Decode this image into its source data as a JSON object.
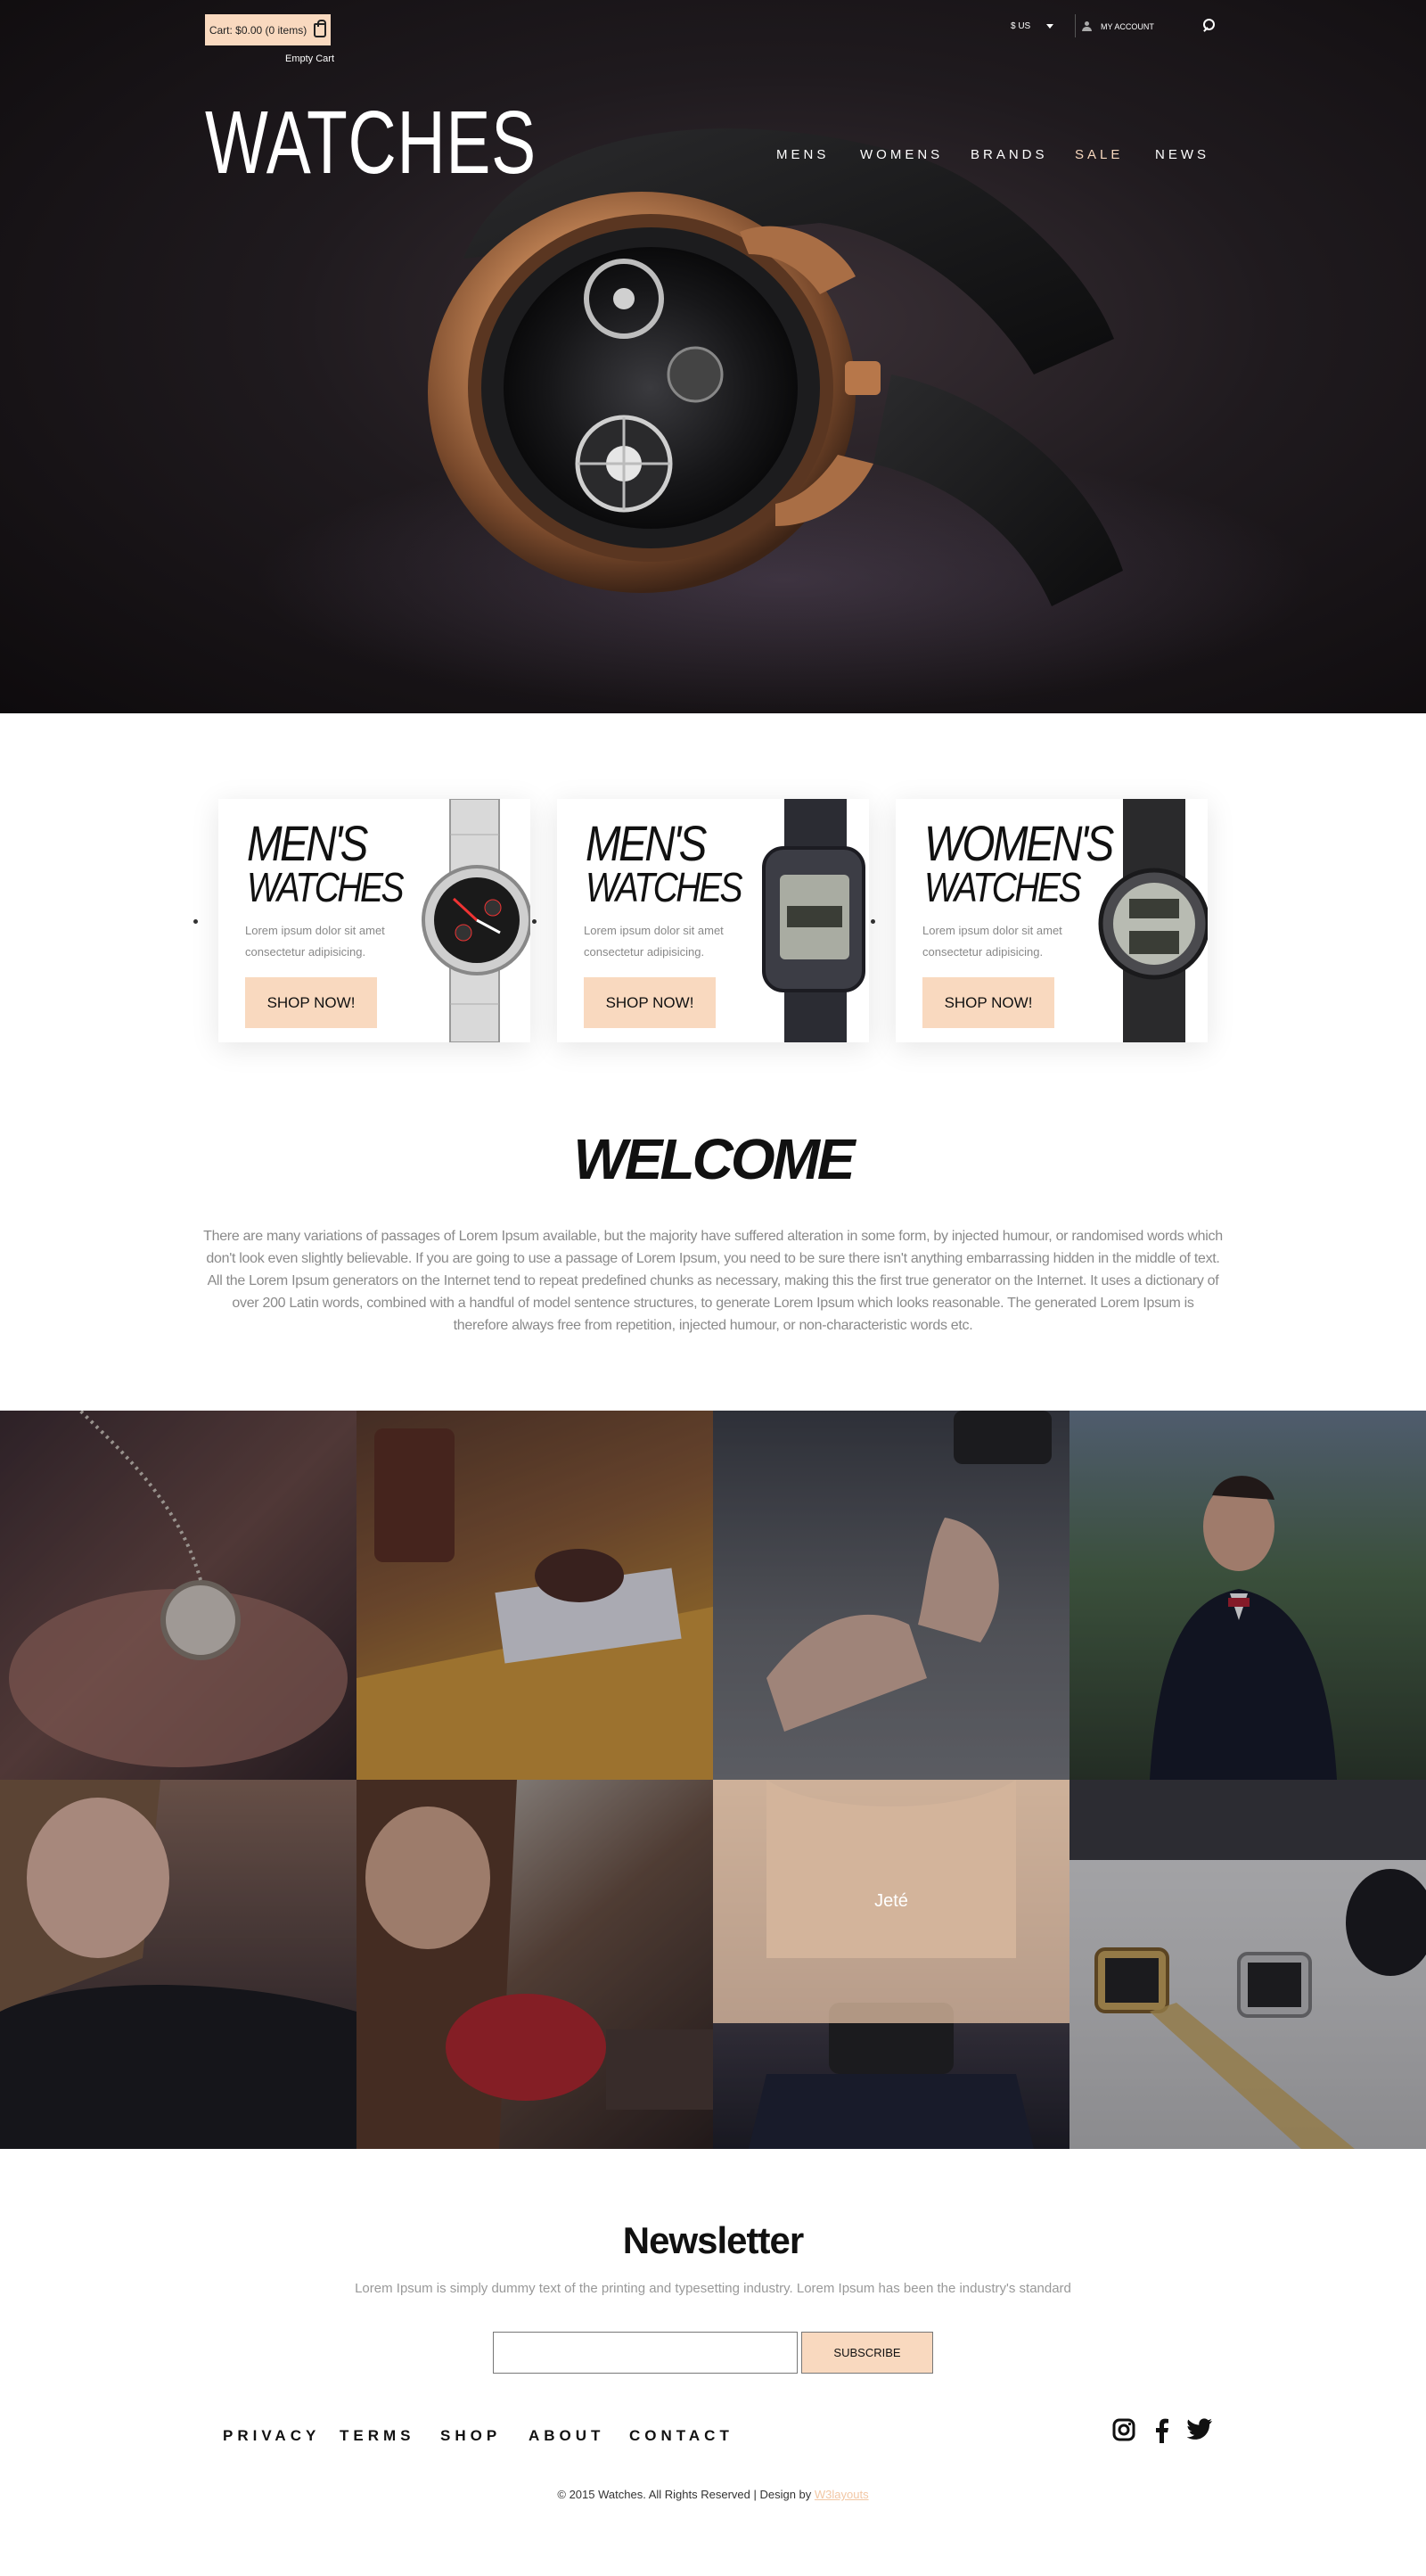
{
  "header": {
    "cart_label": "Cart: $0.00 (0 items)",
    "empty_cart": "Empty Cart",
    "currency": "$ US",
    "account": "MY ACCOUNT",
    "logo": "WATCHES",
    "nav": [
      "MENS",
      "WOMENS",
      "BRANDS",
      "SALE",
      "NEWS"
    ],
    "accent_color": "#f9d9bf"
  },
  "promos": [
    {
      "title1": "MEN'S",
      "title2": "WATCHES",
      "desc": "Lorem ipsum dolor sit amet consectetur adipisicing.",
      "button": "SHOP NOW!"
    },
    {
      "title1": "MEN'S",
      "title2": "WATCHES",
      "desc": "Lorem ipsum dolor sit amet consectetur adipisicing.",
      "button": "SHOP NOW!"
    },
    {
      "title1": "WOMEN'S",
      "title2": "WATCHES",
      "desc": "Lorem ipsum dolor sit amet consectetur adipisicing.",
      "button": "SHOP NOW!"
    }
  ],
  "welcome": {
    "title": "WELCOME",
    "text": "There are many variations of passages of Lorem Ipsum available, but the majority have suffered alteration in some form, by injected humour, or randomised words which don't look even slightly believable. If you are going to use a passage of Lorem Ipsum, you need to be sure there isn't anything embarrassing hidden in the middle of text. All the Lorem Ipsum generators on the Internet tend to repeat predefined chunks as necessary, making this the first true generator on the Internet. It uses a dictionary of over 200 Latin words, combined with a handful of model sentence structures, to generate Lorem Ipsum which looks reasonable. The generated Lorem Ipsum is therefore always free from repetition, injected humour, or non-characteristic words etc."
  },
  "gallery": {
    "hover_label": "Jeté"
  },
  "newsletter": {
    "title": "Newsletter",
    "subtitle": "Lorem Ipsum is simply dummy text of the printing and typesetting industry. Lorem Ipsum has been the industry's standard",
    "button": "SUBSCRIBE"
  },
  "footer": {
    "links": [
      "PRIVACY",
      "TERMS",
      "SHOP",
      "ABOUT",
      "CONTACT"
    ],
    "copyright": "© 2015 Watches. All Rights Reserved | Design by ",
    "designer": "W3layouts",
    "social": [
      "instagram-icon",
      "facebook-icon",
      "twitter-icon"
    ]
  }
}
